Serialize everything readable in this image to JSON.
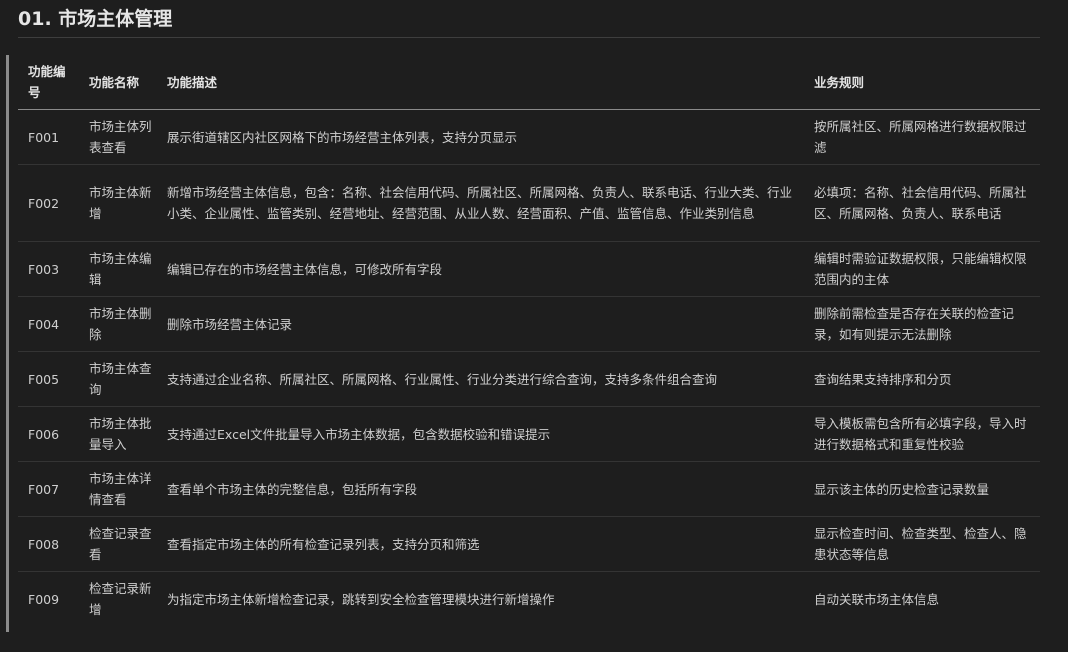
{
  "section": {
    "title": "01. 市场主体管理"
  },
  "table": {
    "headers": [
      "功能编号",
      "功能名称",
      "功能描述",
      "业务规则"
    ],
    "rows": [
      {
        "id": "F001",
        "name": "市场主体列表查看",
        "desc": "展示街道辖区内社区网格下的市场经营主体列表，支持分页显示",
        "rule": "按所属社区、所属网格进行数据权限过滤"
      },
      {
        "id": "F002",
        "name": "市场主体新增",
        "desc": "新增市场经营主体信息，包含：名称、社会信用代码、所属社区、所属网格、负责人、联系电话、行业大类、行业小类、企业属性、监管类别、经营地址、经营范围、从业人数、经营面积、产值、监管信息、作业类别信息",
        "rule": "必填项：名称、社会信用代码、所属社区、所属网格、负责人、联系电话"
      },
      {
        "id": "F003",
        "name": "市场主体编辑",
        "desc": "编辑已存在的市场经营主体信息，可修改所有字段",
        "rule": "编辑时需验证数据权限，只能编辑权限范围内的主体"
      },
      {
        "id": "F004",
        "name": "市场主体删除",
        "desc": "删除市场经营主体记录",
        "rule": "删除前需检查是否存在关联的检查记录，如有则提示无法删除"
      },
      {
        "id": "F005",
        "name": "市场主体查询",
        "desc": "支持通过企业名称、所属社区、所属网格、行业属性、行业分类进行综合查询，支持多条件组合查询",
        "rule": "查询结果支持排序和分页"
      },
      {
        "id": "F006",
        "name": "市场主体批量导入",
        "desc": "支持通过Excel文件批量导入市场主体数据，包含数据校验和错误提示",
        "rule": "导入模板需包含所有必填字段，导入时进行数据格式和重复性校验"
      },
      {
        "id": "F007",
        "name": "市场主体详情查看",
        "desc": "查看单个市场主体的完整信息，包括所有字段",
        "rule": "显示该主体的历史检查记录数量"
      },
      {
        "id": "F008",
        "name": "检查记录查看",
        "desc": "查看指定市场主体的所有检查记录列表，支持分页和筛选",
        "rule": "显示检查时间、检查类型、检查人、隐患状态等信息"
      },
      {
        "id": "F009",
        "name": "检查记录新增",
        "desc": "为指定市场主体新增检查记录，跳转到安全检查管理模块进行新增操作",
        "rule": "自动关联市场主体信息"
      }
    ]
  }
}
